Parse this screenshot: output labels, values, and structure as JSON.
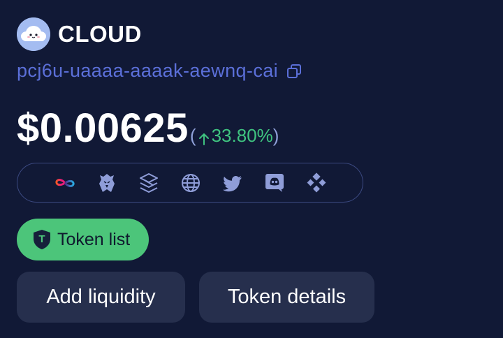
{
  "token": {
    "name": "CLOUD",
    "canister_id": "pcj6u-uaaaa-aaaak-aewnq-cai",
    "price": "$0.00625",
    "change_open": "(",
    "change_pct": "33.80%",
    "change_close": ")"
  },
  "links": [
    {
      "name": "icp-infinity-icon"
    },
    {
      "name": "eagle-icon"
    },
    {
      "name": "layers-icon"
    },
    {
      "name": "globe-icon"
    },
    {
      "name": "twitter-icon"
    },
    {
      "name": "discord-icon"
    },
    {
      "name": "diamond-grid-icon"
    }
  ],
  "buttons": {
    "token_list": "Token list",
    "token_list_badge": "T",
    "add_liquidity": "Add liquidity",
    "token_details": "Token details"
  },
  "colors": {
    "background": "#111936",
    "canister_link": "#5b6fd8",
    "positive": "#3fc380",
    "token_list_bg": "#4cc57a",
    "button_bg": "#262f4d",
    "icon_color": "#8f9dd8"
  }
}
